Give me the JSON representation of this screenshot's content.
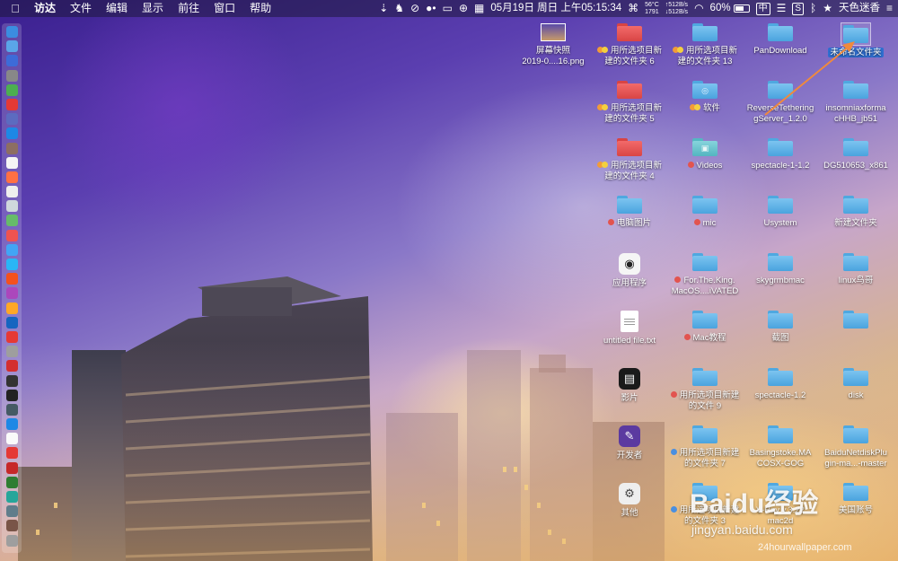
{
  "menubar": {
    "apple_icon": "apple-logo",
    "app_name": "访达",
    "menus": [
      "文件",
      "编辑",
      "显示",
      "前往",
      "窗口",
      "帮助"
    ],
    "datetime": "05月19日 周日 上午05:15:34",
    "temp": "56°C",
    "rpm": "1791",
    "net_up": "↑512B/s",
    "net_down": "↓512B/s",
    "battery": "60%",
    "input_cn": "中",
    "input_s": "S",
    "user_name": "天色迷香"
  },
  "desktop": {
    "items": [
      {
        "id": "screenshot",
        "label": "屏幕快照\n2019-0....16.png",
        "tag": null
      },
      {
        "id": "folder6",
        "label": "用所选项目新\n建的文件夹 6",
        "tag": "orange-yellow"
      },
      {
        "id": "folder13",
        "label": "用所选项目新\n建的文件夹 13",
        "tag": "orange-yellow"
      },
      {
        "id": "pandownload",
        "label": "PanDownload",
        "tag": null
      },
      {
        "id": "untitled-folder",
        "label": "未命名文件夹",
        "tag": null
      },
      {
        "id": "folder5",
        "label": "用所选项目新\n建的文件夹 5",
        "tag": "orange-yellow"
      },
      {
        "id": "software",
        "label": "软件",
        "tag": "orange-yellow"
      },
      {
        "id": "reversetethering",
        "label": "ReverseTethering\ngServer_1.2.0",
        "tag": null
      },
      {
        "id": "insomniax",
        "label": "insomniaxforma\ncHHB_jb51",
        "tag": null
      },
      {
        "id": "folder4",
        "label": "用所选项目新\n建的文件夹 4",
        "tag": "orange-yellow"
      },
      {
        "id": "videos",
        "label": "Videos",
        "tag": "red"
      },
      {
        "id": "spectacle112",
        "label": "spectacle-1-1.2",
        "tag": null
      },
      {
        "id": "dg510653",
        "label": "DG510653_x861",
        "tag": null
      },
      {
        "id": "pc-pictures",
        "label": "电脑图片",
        "tag": "red"
      },
      {
        "id": "mic",
        "label": "mic",
        "tag": "red"
      },
      {
        "id": "usystem",
        "label": "Usystem",
        "tag": null
      },
      {
        "id": "new-folder",
        "label": "新建文件夹",
        "tag": null
      },
      {
        "id": "applications",
        "label": "应用程序",
        "tag": null
      },
      {
        "id": "fortheking",
        "label": "For.The.King.\nMacOS....iVATED",
        "tag": "red"
      },
      {
        "id": "skygrm",
        "label": "skygrmbmac",
        "tag": null
      },
      {
        "id": "linux",
        "label": "linux鸟哥",
        "tag": null
      },
      {
        "id": "untitled-txt",
        "label": "untitled file.txt",
        "tag": null
      },
      {
        "id": "mac-tutorial",
        "label": "Mac教程",
        "tag": "red"
      },
      {
        "id": "screenshots-cn",
        "label": "截图",
        "tag": null
      },
      {
        "id": "blank-folder",
        "label": "",
        "tag": null
      },
      {
        "id": "movies",
        "label": "影片",
        "tag": null
      },
      {
        "id": "folder9",
        "label": "用所选项目新建\n的文件 9",
        "tag": "red"
      },
      {
        "id": "spectacle12",
        "label": "spectacle-1.2",
        "tag": null
      },
      {
        "id": "disk",
        "label": "disk",
        "tag": null
      },
      {
        "id": "developer",
        "label": "开发者",
        "tag": null
      },
      {
        "id": "folder7",
        "label": "用所选项目新建\n的文件夹 7",
        "tag": "blue"
      },
      {
        "id": "basingstoke",
        "label": "Basingstoke.MA\nCOSX-GOG",
        "tag": null
      },
      {
        "id": "baidunetdisk",
        "label": "BaiduNetdiskPlu\ngin-ma...-master",
        "tag": null
      },
      {
        "id": "other",
        "label": "其他",
        "tag": null
      },
      {
        "id": "folder3",
        "label": "用所选项目新建\n的文件夹 3",
        "tag": "blue"
      },
      {
        "id": "vcray",
        "label": "V-Ray v.3.22\nmac2d",
        "tag": null
      },
      {
        "id": "us-account",
        "label": "美国账号",
        "tag": null
      }
    ]
  },
  "watermark": {
    "baidu": "Baidu经验",
    "jingyan": "jingyan.baidu.com",
    "wallpaper": "24hourwallpaper.com"
  },
  "colors": {
    "selection": "#2f6fd1",
    "arrow": "#f08a3c",
    "folder_blue": "#4aa3de",
    "folder_red": "#d94545"
  }
}
